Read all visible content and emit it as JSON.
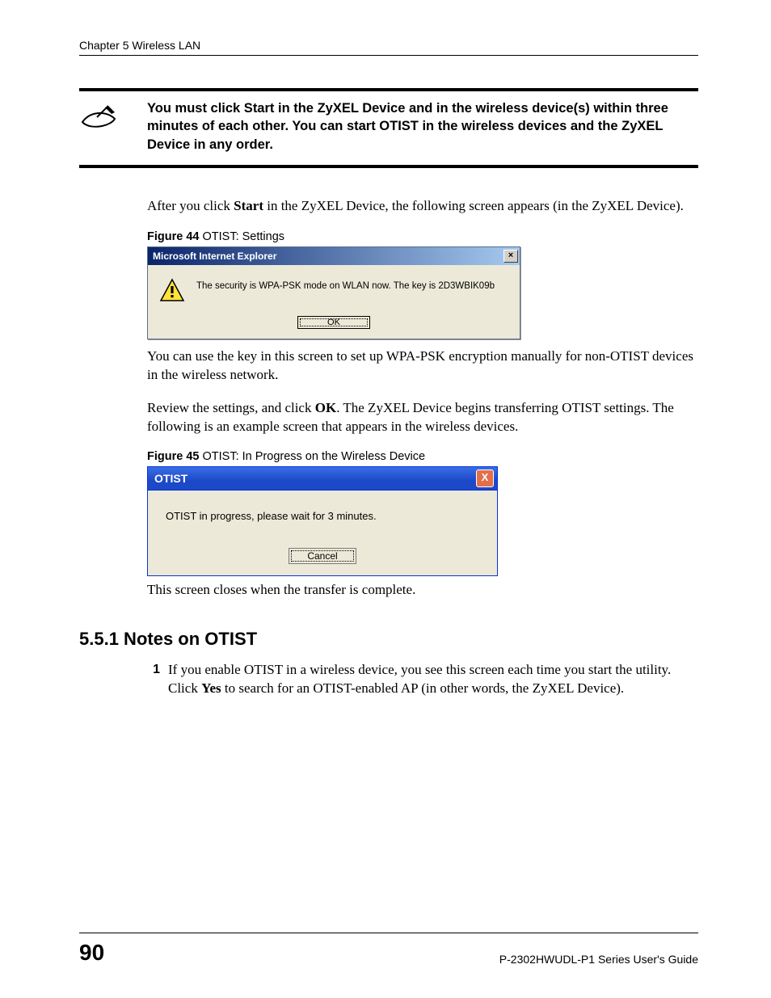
{
  "header": {
    "chapter": "Chapter 5 Wireless LAN"
  },
  "note": {
    "text": "You must click Start in the ZyXEL Device and in the wireless device(s) within three minutes of each other. You can start OTIST in the wireless devices and the ZyXEL Device in any order."
  },
  "para1_a": "After you click ",
  "para1_bold": "Start",
  "para1_b": " in the ZyXEL Device, the following screen appears (in the ZyXEL Device).",
  "fig44": {
    "label": "Figure 44",
    "caption": "   OTIST: Settings",
    "title": "Microsoft Internet Explorer",
    "message": "The security is WPA-PSK mode on WLAN now. The key is 2D3WBIK09b",
    "ok": "OK",
    "close_glyph": "×"
  },
  "para2": "You can use the key in this screen to set up WPA-PSK encryption manually for non-OTIST devices in the wireless network.",
  "para3_a": "Review the settings, and click ",
  "para3_bold": "OK",
  "para3_b": ". The ZyXEL Device begins transferring OTIST settings. The following is an example screen that appears in the wireless devices.",
  "fig45": {
    "label": "Figure 45",
    "caption": "   OTIST: In Progress on the Wireless Device",
    "title": "OTIST",
    "message": "OTIST in progress, please wait for 3 minutes.",
    "cancel": "Cancel",
    "close_glyph": "X"
  },
  "para4": "This screen closes when the transfer is complete.",
  "section": {
    "number": "5.5.1",
    "title": "  Notes on OTIST"
  },
  "list": {
    "item1_num": "1",
    "item1_a": "If you enable OTIST in a wireless device, you see this screen each time you start the utility. Click ",
    "item1_bold": "Yes",
    "item1_b": " to search for an OTIST-enabled AP (in other words, the ZyXEL Device)."
  },
  "footer": {
    "page": "90",
    "guide": "P-2302HWUDL-P1 Series User's Guide"
  }
}
